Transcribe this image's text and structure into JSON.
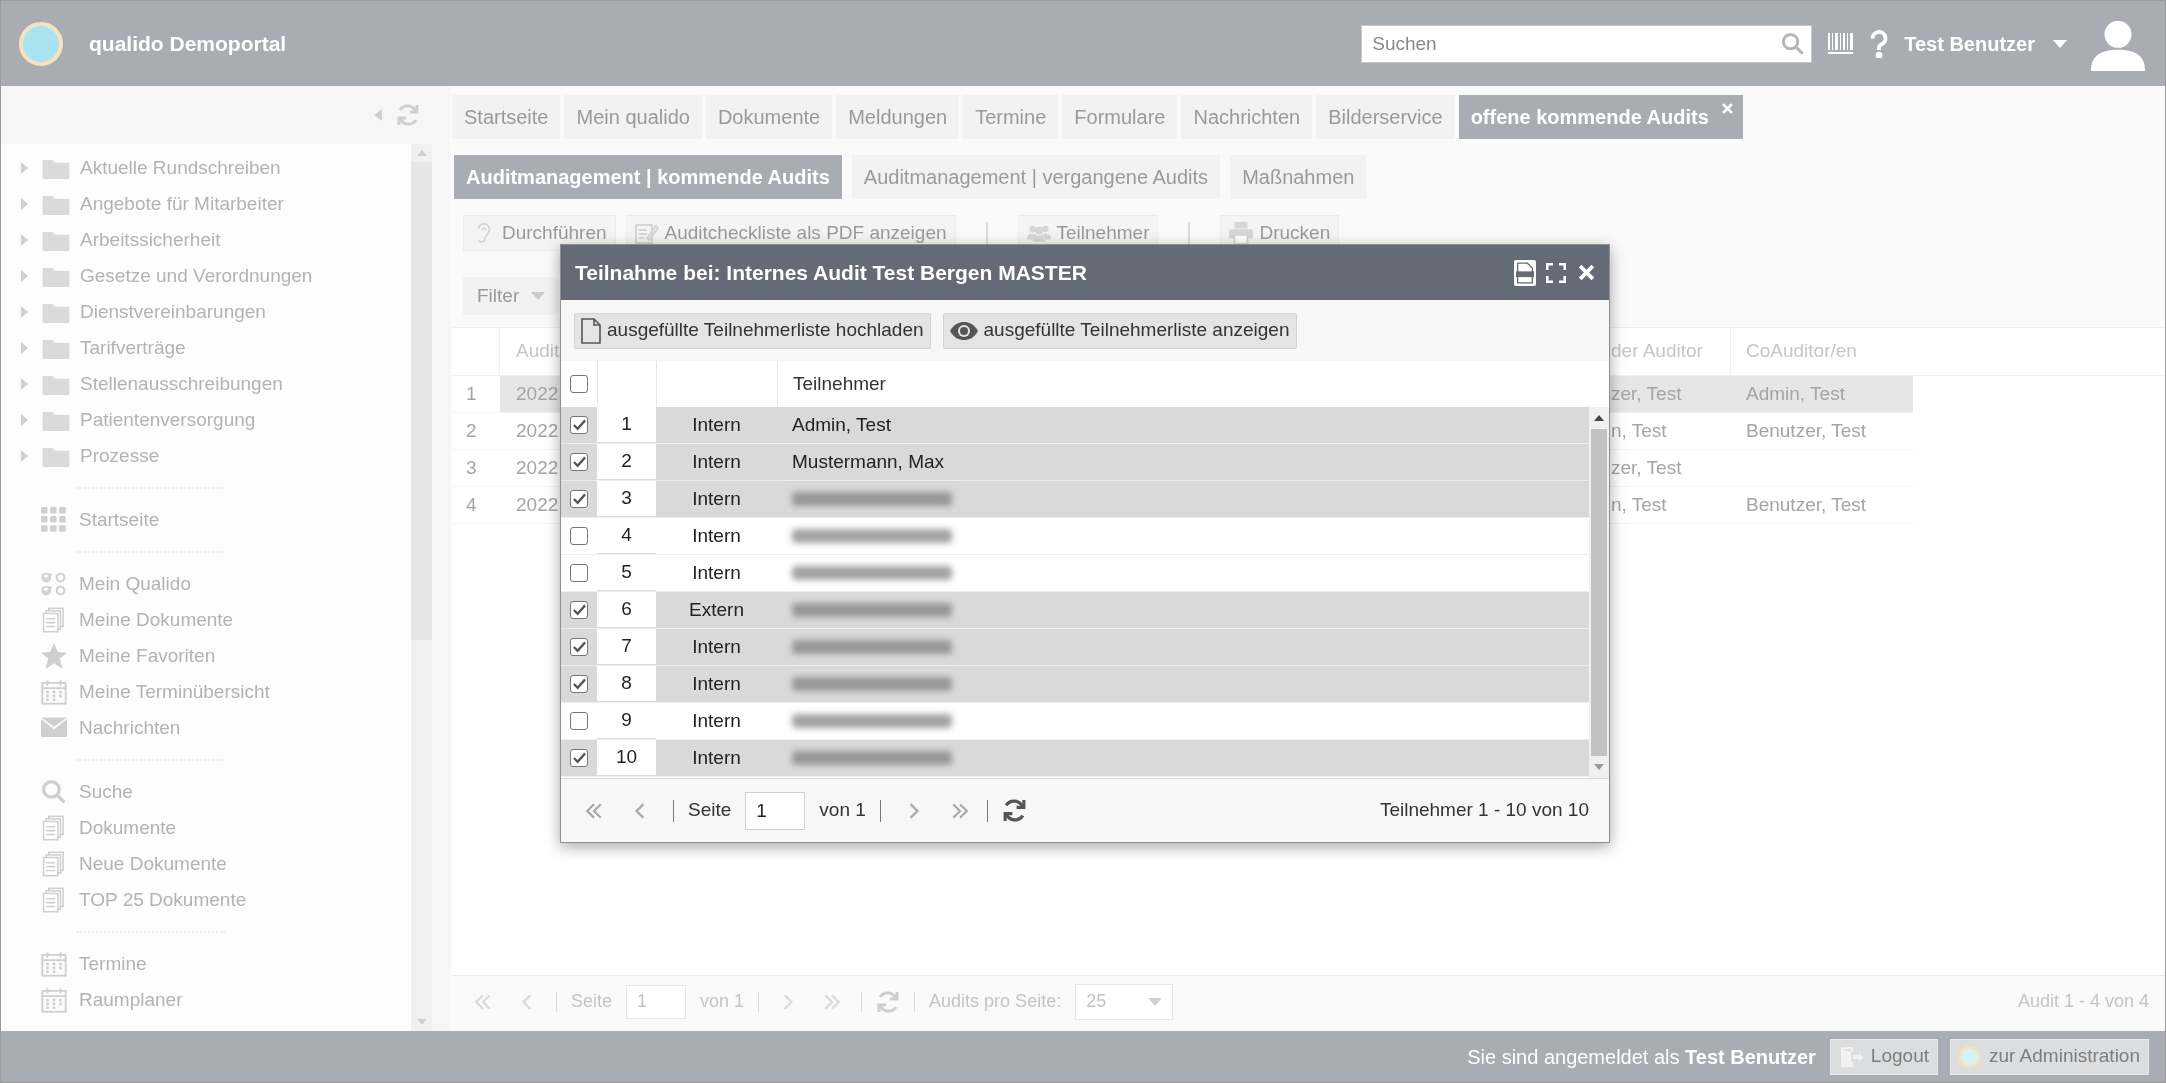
{
  "header": {
    "title": "qualido Demoportal",
    "search": {
      "placeholder": "Suchen"
    },
    "user": "Test Benutzer"
  },
  "sidebar": {
    "folders": [
      "Aktuelle Rundschreiben",
      "Angebote für Mitarbeiter",
      "Arbeitssicherheit",
      "Gesetze und Verordnungen",
      "Dienstvereinbarungen",
      "Tarifverträge",
      "Stellenausschreibungen",
      "Patientenversorgung",
      "Prozesse"
    ],
    "groups": [
      [
        {
          "label": "Startseite",
          "kind": "grid"
        }
      ],
      [
        {
          "label": "Mein Qualido",
          "kind": "checks"
        },
        {
          "label": "Meine Dokumente",
          "kind": "docs"
        },
        {
          "label": "Meine Favoriten",
          "kind": "star"
        },
        {
          "label": "Meine Terminübersicht",
          "kind": "calendar"
        },
        {
          "label": "Nachrichten",
          "kind": "mail"
        }
      ],
      [
        {
          "label": "Suche",
          "kind": "search"
        },
        {
          "label": "Dokumente",
          "kind": "docs"
        },
        {
          "label": "Neue Dokumente",
          "kind": "docs"
        },
        {
          "label": "TOP 25 Dokumente",
          "kind": "docs"
        }
      ],
      [
        {
          "label": "Termine",
          "kind": "calendar"
        },
        {
          "label": "Raumplaner",
          "kind": "calendar"
        }
      ]
    ]
  },
  "main_tabs": [
    {
      "label": "Startseite",
      "selected": false,
      "closable": false
    },
    {
      "label": "Mein qualido",
      "selected": false,
      "closable": false
    },
    {
      "label": "Dokumente",
      "selected": false,
      "closable": false
    },
    {
      "label": "Meldungen",
      "selected": false,
      "closable": false
    },
    {
      "label": "Termine",
      "selected": false,
      "closable": false
    },
    {
      "label": "Formulare",
      "selected": false,
      "closable": false
    },
    {
      "label": "Nachrichten",
      "selected": false,
      "closable": false
    },
    {
      "label": "Bilderservice",
      "selected": false,
      "closable": false
    },
    {
      "label": "offene kommende Audits",
      "selected": true,
      "closable": true
    }
  ],
  "sub_tabs": [
    {
      "label": "Auditmanagement | kommende Audits",
      "selected": true
    },
    {
      "label": "Auditmanagement | vergangene Audits",
      "selected": false
    },
    {
      "label": "Maßnahmen",
      "selected": false
    }
  ],
  "toolbar": [
    {
      "kind": "ear",
      "label": "Durchführen"
    },
    {
      "kind": "edit",
      "label": "Auditcheckliste als PDF anzeigen"
    },
    {
      "kind": "separator"
    },
    {
      "kind": "users",
      "label": "Teilnehmer"
    },
    {
      "kind": "separator"
    },
    {
      "kind": "print",
      "label": "Drucken"
    }
  ],
  "filter": {
    "label": "Filter"
  },
  "table": {
    "columns": [
      "Audit",
      "der Auditor",
      "CoAuditor/en"
    ],
    "rows": [
      {
        "number": "1",
        "audit": "2022",
        "auditor": "zer, Test",
        "coauditor": "Admin, Test",
        "selected": true
      },
      {
        "number": "2",
        "audit": "2022",
        "auditor": "n, Test",
        "coauditor": "Benutzer, Test",
        "selected": false
      },
      {
        "number": "3",
        "audit": "2022",
        "auditor": "zer, Test",
        "selected": false
      },
      {
        "number": "4",
        "audit": "2022",
        "auditor": "n, Test",
        "coauditor": "Benutzer, Test",
        "selected": false
      }
    ]
  },
  "pager": {
    "page_label": "Seite",
    "page": "1",
    "of": "von 1",
    "per_page_label": "Audits pro Seite:",
    "per_page": "25",
    "summary": "Audit 1 - 4 von 4"
  },
  "footer": {
    "login_text": "Sie sind angemeldet als **Test Benutzer**",
    "buttons": [
      {
        "label": "Logout",
        "kind": "logout"
      },
      {
        "label": "zur Administration",
        "kind": "logo"
      }
    ]
  },
  "dialog": {
    "title": "Teilnahme bei: Internes Audit Test Bergen MASTER",
    "buttons": [
      {
        "label": "ausgefüllte Teilnehmerliste hochladen",
        "kind": "file"
      },
      {
        "label": "ausgefüllte Teilnehmerliste anzeigen",
        "kind": "eye"
      }
    ],
    "select_all": {
      "checked": false
    },
    "column": "Teilnehmer",
    "rows": [
      {
        "number": "1",
        "type": "Intern",
        "name": "Admin, Test",
        "checked": true
      },
      {
        "number": "2",
        "type": "Intern",
        "name": "Mustermann, Max",
        "checked": true
      },
      {
        "number": "3",
        "type": "Intern",
        "blurred": true,
        "checked": true
      },
      {
        "number": "4",
        "type": "Intern",
        "blurred": true,
        "checked": false
      },
      {
        "number": "5",
        "type": "Intern",
        "blurred": true,
        "checked": false
      },
      {
        "number": "6",
        "type": "Extern",
        "blurred": true,
        "checked": true
      },
      {
        "number": "7",
        "type": "Intern",
        "blurred": true,
        "checked": true
      },
      {
        "number": "8",
        "type": "Intern",
        "blurred": true,
        "checked": true
      },
      {
        "number": "9",
        "type": "Intern",
        "blurred": true,
        "checked": false
      },
      {
        "number": "10",
        "type": "Intern",
        "blurred": true,
        "checked": true
      }
    ],
    "pager": {
      "page_label": "Seite",
      "page": "1",
      "of": "von 1",
      "summary": "Teilnehmer 1 - 10 von 10"
    }
  }
}
